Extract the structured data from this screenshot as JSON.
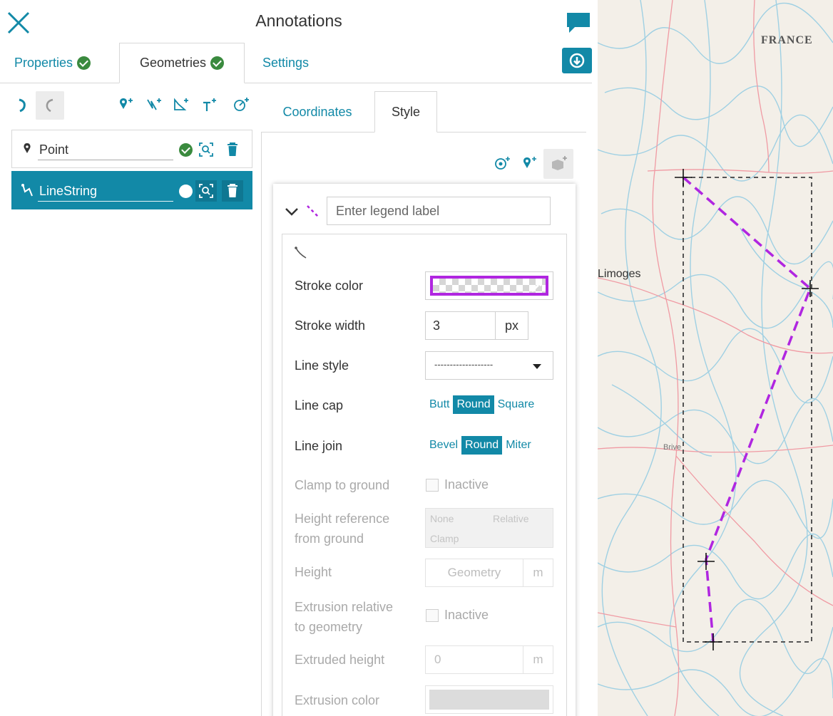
{
  "header": {
    "title": "Annotations"
  },
  "tabs": [
    {
      "label": "Properties",
      "checked": true
    },
    {
      "label": "Geometries",
      "checked": true
    },
    {
      "label": "Settings",
      "checked": false
    }
  ],
  "geometries": [
    {
      "label": "Point",
      "type": "point",
      "selected": false
    },
    {
      "label": "LineString",
      "type": "linestring",
      "selected": true
    }
  ],
  "subtabs": {
    "coordinates": "Coordinates",
    "style": "Style"
  },
  "legend": {
    "placeholder": "Enter legend label"
  },
  "style_form": {
    "stroke_color": {
      "label": "Stroke color",
      "value": "#b026e0"
    },
    "stroke_width": {
      "label": "Stroke width",
      "value": "3",
      "unit": "px"
    },
    "line_style": {
      "label": "Line style",
      "value": "-------------------"
    },
    "line_cap": {
      "label": "Line cap",
      "options": [
        "Butt",
        "Round",
        "Square"
      ],
      "selected": "Round"
    },
    "line_join": {
      "label": "Line join",
      "options": [
        "Bevel",
        "Round",
        "Miter"
      ],
      "selected": "Round"
    },
    "clamp_to_ground": {
      "label": "Clamp to ground",
      "state": "Inactive"
    },
    "height_reference": {
      "label_1": "Height reference",
      "label_2": "from ground",
      "options": [
        "None",
        "Relative",
        "Clamp"
      ]
    },
    "height": {
      "label": "Height",
      "placeholder": "Geometry",
      "unit": "m"
    },
    "extrusion_relative": {
      "label_1": "Extrusion relative",
      "label_2": "to geometry",
      "state": "Inactive"
    },
    "extruded_height": {
      "label": "Extruded height",
      "value": "0",
      "unit": "m"
    },
    "extrusion_color": {
      "label": "Extrusion color"
    }
  },
  "map": {
    "labels": {
      "france": "FRANCE",
      "limoges": "Limoges",
      "brive": "Brive"
    }
  },
  "colors": {
    "accent": "#1289a7",
    "check": "#3a8a3e",
    "stroke": "#b026e0"
  }
}
